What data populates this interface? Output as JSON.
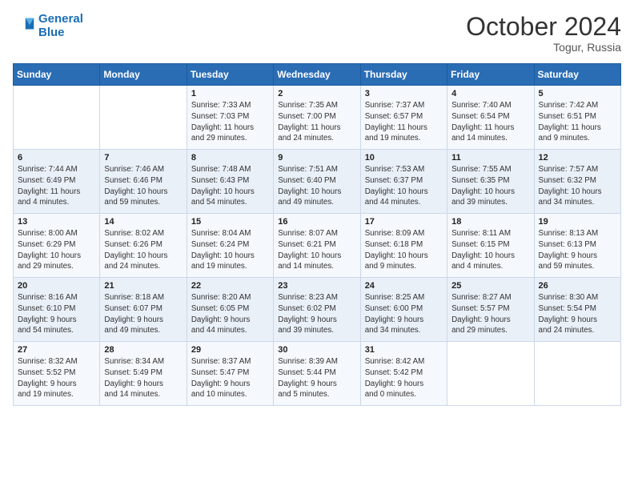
{
  "logo": {
    "line1": "General",
    "line2": "Blue"
  },
  "title": "October 2024",
  "location": "Togur, Russia",
  "days_header": [
    "Sunday",
    "Monday",
    "Tuesday",
    "Wednesday",
    "Thursday",
    "Friday",
    "Saturday"
  ],
  "weeks": [
    [
      {
        "day": "",
        "content": ""
      },
      {
        "day": "",
        "content": ""
      },
      {
        "day": "1",
        "content": "Sunrise: 7:33 AM\nSunset: 7:03 PM\nDaylight: 11 hours\nand 29 minutes."
      },
      {
        "day": "2",
        "content": "Sunrise: 7:35 AM\nSunset: 7:00 PM\nDaylight: 11 hours\nand 24 minutes."
      },
      {
        "day": "3",
        "content": "Sunrise: 7:37 AM\nSunset: 6:57 PM\nDaylight: 11 hours\nand 19 minutes."
      },
      {
        "day": "4",
        "content": "Sunrise: 7:40 AM\nSunset: 6:54 PM\nDaylight: 11 hours\nand 14 minutes."
      },
      {
        "day": "5",
        "content": "Sunrise: 7:42 AM\nSunset: 6:51 PM\nDaylight: 11 hours\nand 9 minutes."
      }
    ],
    [
      {
        "day": "6",
        "content": "Sunrise: 7:44 AM\nSunset: 6:49 PM\nDaylight: 11 hours\nand 4 minutes."
      },
      {
        "day": "7",
        "content": "Sunrise: 7:46 AM\nSunset: 6:46 PM\nDaylight: 10 hours\nand 59 minutes."
      },
      {
        "day": "8",
        "content": "Sunrise: 7:48 AM\nSunset: 6:43 PM\nDaylight: 10 hours\nand 54 minutes."
      },
      {
        "day": "9",
        "content": "Sunrise: 7:51 AM\nSunset: 6:40 PM\nDaylight: 10 hours\nand 49 minutes."
      },
      {
        "day": "10",
        "content": "Sunrise: 7:53 AM\nSunset: 6:37 PM\nDaylight: 10 hours\nand 44 minutes."
      },
      {
        "day": "11",
        "content": "Sunrise: 7:55 AM\nSunset: 6:35 PM\nDaylight: 10 hours\nand 39 minutes."
      },
      {
        "day": "12",
        "content": "Sunrise: 7:57 AM\nSunset: 6:32 PM\nDaylight: 10 hours\nand 34 minutes."
      }
    ],
    [
      {
        "day": "13",
        "content": "Sunrise: 8:00 AM\nSunset: 6:29 PM\nDaylight: 10 hours\nand 29 minutes."
      },
      {
        "day": "14",
        "content": "Sunrise: 8:02 AM\nSunset: 6:26 PM\nDaylight: 10 hours\nand 24 minutes."
      },
      {
        "day": "15",
        "content": "Sunrise: 8:04 AM\nSunset: 6:24 PM\nDaylight: 10 hours\nand 19 minutes."
      },
      {
        "day": "16",
        "content": "Sunrise: 8:07 AM\nSunset: 6:21 PM\nDaylight: 10 hours\nand 14 minutes."
      },
      {
        "day": "17",
        "content": "Sunrise: 8:09 AM\nSunset: 6:18 PM\nDaylight: 10 hours\nand 9 minutes."
      },
      {
        "day": "18",
        "content": "Sunrise: 8:11 AM\nSunset: 6:15 PM\nDaylight: 10 hours\nand 4 minutes."
      },
      {
        "day": "19",
        "content": "Sunrise: 8:13 AM\nSunset: 6:13 PM\nDaylight: 9 hours\nand 59 minutes."
      }
    ],
    [
      {
        "day": "20",
        "content": "Sunrise: 8:16 AM\nSunset: 6:10 PM\nDaylight: 9 hours\nand 54 minutes."
      },
      {
        "day": "21",
        "content": "Sunrise: 8:18 AM\nSunset: 6:07 PM\nDaylight: 9 hours\nand 49 minutes."
      },
      {
        "day": "22",
        "content": "Sunrise: 8:20 AM\nSunset: 6:05 PM\nDaylight: 9 hours\nand 44 minutes."
      },
      {
        "day": "23",
        "content": "Sunrise: 8:23 AM\nSunset: 6:02 PM\nDaylight: 9 hours\nand 39 minutes."
      },
      {
        "day": "24",
        "content": "Sunrise: 8:25 AM\nSunset: 6:00 PM\nDaylight: 9 hours\nand 34 minutes."
      },
      {
        "day": "25",
        "content": "Sunrise: 8:27 AM\nSunset: 5:57 PM\nDaylight: 9 hours\nand 29 minutes."
      },
      {
        "day": "26",
        "content": "Sunrise: 8:30 AM\nSunset: 5:54 PM\nDaylight: 9 hours\nand 24 minutes."
      }
    ],
    [
      {
        "day": "27",
        "content": "Sunrise: 8:32 AM\nSunset: 5:52 PM\nDaylight: 9 hours\nand 19 minutes."
      },
      {
        "day": "28",
        "content": "Sunrise: 8:34 AM\nSunset: 5:49 PM\nDaylight: 9 hours\nand 14 minutes."
      },
      {
        "day": "29",
        "content": "Sunrise: 8:37 AM\nSunset: 5:47 PM\nDaylight: 9 hours\nand 10 minutes."
      },
      {
        "day": "30",
        "content": "Sunrise: 8:39 AM\nSunset: 5:44 PM\nDaylight: 9 hours\nand 5 minutes."
      },
      {
        "day": "31",
        "content": "Sunrise: 8:42 AM\nSunset: 5:42 PM\nDaylight: 9 hours\nand 0 minutes."
      },
      {
        "day": "",
        "content": ""
      },
      {
        "day": "",
        "content": ""
      }
    ]
  ]
}
